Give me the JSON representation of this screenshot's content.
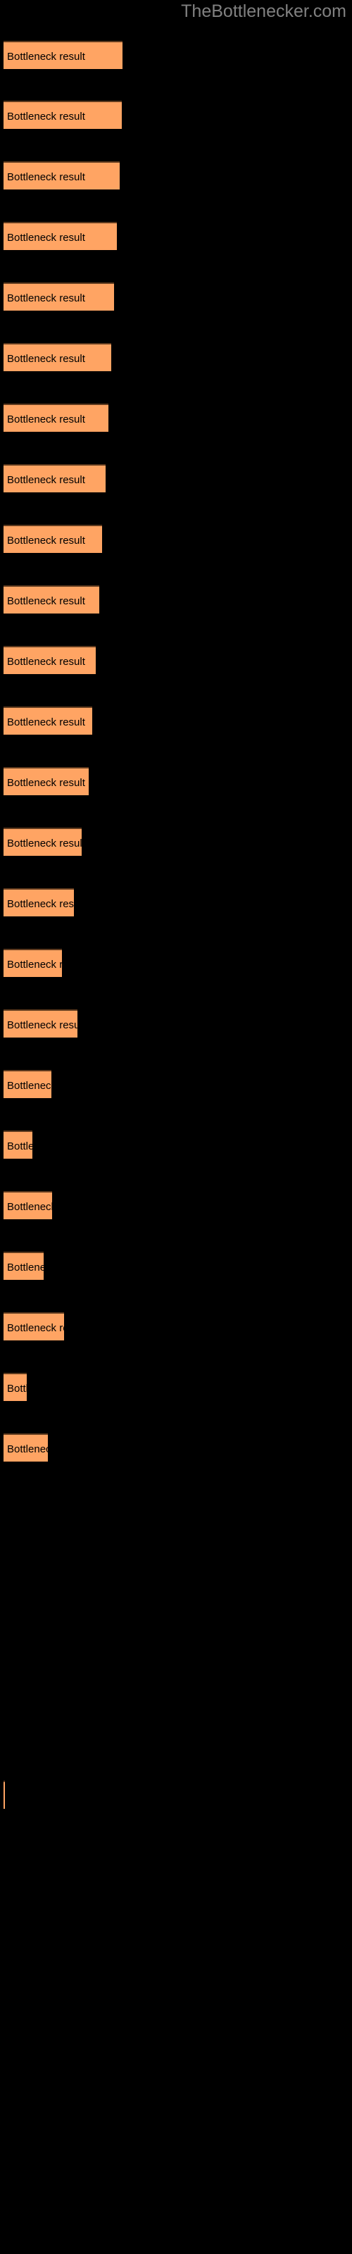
{
  "site": {
    "title": "TheBottlenecker.com"
  },
  "colors": {
    "background": "#000000",
    "bar_fill": "#FFA463",
    "bar_border_top": "#5E3A1E",
    "title_text": "#808080",
    "label_text": "#000000"
  },
  "chart_data": {
    "type": "bar",
    "orientation": "horizontal",
    "title": "TheBottlenecker.com",
    "xlabel": "",
    "ylabel": "",
    "grid": false,
    "legend_position": "bottom-left",
    "bar_label_text": "Bottleneck result",
    "categories": [
      "Bottleneck result",
      "Bottleneck result",
      "Bottleneck result",
      "Bottleneck result",
      "Bottleneck result",
      "Bottleneck result",
      "Bottleneck result",
      "Bottleneck result",
      "Bottleneck result",
      "Bottleneck result",
      "Bottleneck result",
      "Bottleneck result",
      "Bottleneck result",
      "Bottleneck result",
      "Bottleneck result",
      "Bottleneck result",
      "Bottleneck result",
      "Bottleneck result",
      "Bottleneck result",
      "Bottleneck result",
      "Bottleneck result",
      "Bottleneck result",
      "Bottleneck result",
      "Bottleneck result"
    ],
    "values": [
      169,
      168,
      165,
      161,
      157,
      153,
      149,
      145,
      140,
      136,
      131,
      126,
      121,
      111,
      100,
      83,
      75,
      68,
      60,
      48,
      63,
      54,
      38,
      55
    ],
    "xlim": [
      0,
      500
    ],
    "bars": [
      {
        "label": "Bottleneck result",
        "width": 169,
        "top": 58
      },
      {
        "label": "Bottleneck result",
        "width": 168,
        "top": 143
      },
      {
        "label": "Bottleneck result",
        "width": 165,
        "top": 229
      },
      {
        "label": "Bottleneck result",
        "width": 161,
        "top": 315
      },
      {
        "label": "Bottleneck result",
        "width": 157,
        "top": 401
      },
      {
        "label": "Bottleneck result",
        "width": 153,
        "top": 487
      },
      {
        "label": "Bottleneck result",
        "width": 149,
        "top": 573
      },
      {
        "label": "Bottleneck result",
        "width": 145,
        "top": 659
      },
      {
        "label": "Bottleneck result",
        "width": 140,
        "top": 745
      },
      {
        "label": "Bottleneck result",
        "width": 136,
        "top": 831
      },
      {
        "label": "Bottleneck result",
        "width": 131,
        "top": 917
      },
      {
        "label": "Bottleneck result",
        "width": 126,
        "top": 1003
      },
      {
        "label": "Bottleneck result",
        "width": 121,
        "top": 1089
      },
      {
        "label": "Bottleneck result",
        "width": 111,
        "top": 1175
      },
      {
        "label": "Bottleneck result",
        "width": 100,
        "top": 1261
      },
      {
        "label": "Bottleneck result",
        "width": 83,
        "top": 1347
      },
      {
        "label": "Bottleneck result",
        "width": 105,
        "top": 1433
      },
      {
        "label": "Bottleneck result",
        "width": 68,
        "top": 1519
      },
      {
        "label": "Bottleneck result",
        "width": 41,
        "top": 1605
      },
      {
        "label": "Bottleneck result",
        "width": 69,
        "top": 1691
      },
      {
        "label": "Bottleneck result",
        "width": 57,
        "top": 1777
      },
      {
        "label": "Bottleneck result",
        "width": 86,
        "top": 1863
      },
      {
        "label": "Bottleneck result",
        "width": 33,
        "top": 1949
      },
      {
        "label": "Bottleneck result",
        "width": 63,
        "top": 2035
      }
    ]
  },
  "legend": {
    "swatch_color": "#FFA463"
  }
}
